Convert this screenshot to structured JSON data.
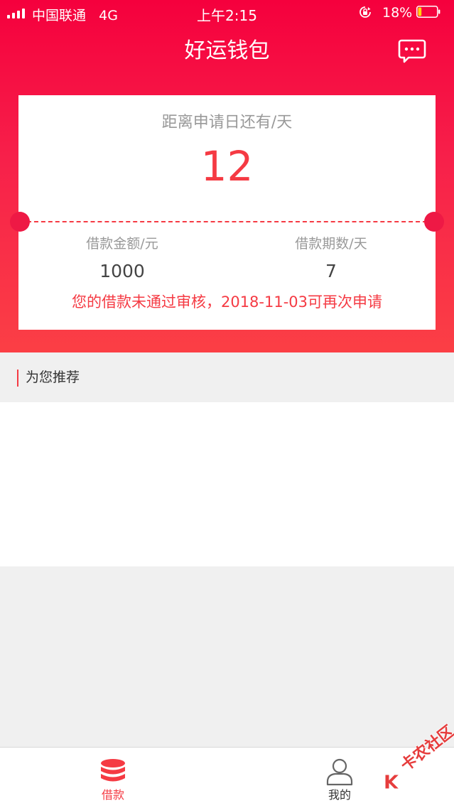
{
  "status_bar": {
    "carrier": "中国联通",
    "network": "4G",
    "time": "上午2:15",
    "battery": "18%",
    "battery_level": 0.18
  },
  "nav": {
    "title": "好运钱包",
    "message_icon": "message-icon"
  },
  "card": {
    "days_label": "距离申请日还有/天",
    "days_value": "12",
    "amount_label": "借款金额/元",
    "amount_value": "1000",
    "term_label": "借款期数/天",
    "term_value": "7",
    "notice": "您的借款未通过审核，2018-11-03可再次申请"
  },
  "section": {
    "title": "为您推荐"
  },
  "tabs": [
    {
      "label": "借款",
      "icon": "coins-stack-icon",
      "active": true
    },
    {
      "label": "我的",
      "icon": "user-icon",
      "active": false
    }
  ],
  "watermark": {
    "text": "卡农社区"
  },
  "colors": {
    "brand": "#f5003d",
    "accent": "#f53a43",
    "muted": "#999999",
    "active_tab": "#f53a43",
    "inactive_tab": "#333333"
  }
}
